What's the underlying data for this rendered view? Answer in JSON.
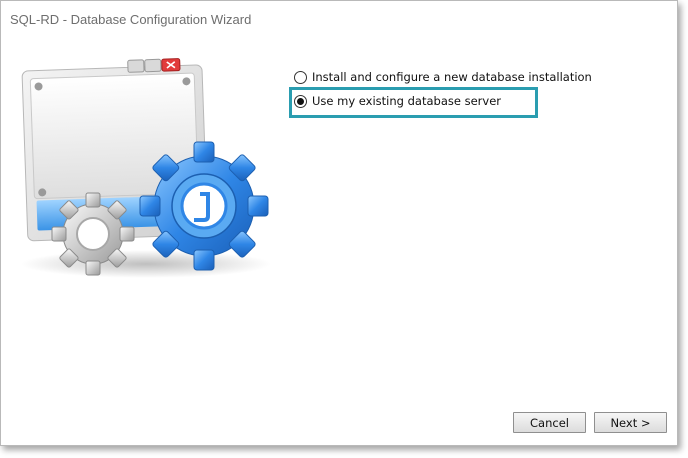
{
  "window": {
    "title": "SQL-RD - Database Configuration Wizard"
  },
  "illustration": {
    "icon": "database-config-wizard-icon"
  },
  "options": [
    {
      "label": "Install and configure a new database installation",
      "selected": false
    },
    {
      "label": "Use my existing database server",
      "selected": true
    }
  ],
  "buttons": {
    "cancel": "Cancel",
    "next": "Next >"
  },
  "colors": {
    "highlight": "#2a9db0",
    "gear_blue": "#2f86e6"
  }
}
